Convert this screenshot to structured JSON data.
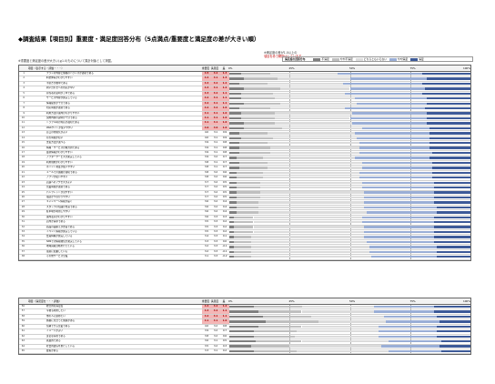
{
  "title": "◆調査結果【項目別】重要度・満足度回答分布（5点満点/重要度と満足度の差が大きい順）",
  "note_left": "※重要度と満足度の差が大きい(≧1.0)ものについて集計対象として掲載。",
  "note_right": [
    "※満足度の差が1.0以上の",
    "項目を赤で網掛けしています。"
  ],
  "legend": {
    "caption": "満足度の回答分布",
    "items": [
      {
        "label": "不満足",
        "color": "#7f7f7f"
      },
      {
        "label": "やや不満足",
        "color": "#bfbfbf"
      },
      {
        "label": "どちらともいえない",
        "color": "#dcdcdc"
      },
      {
        "label": "やや満足",
        "color": "#9aaed6"
      },
      {
        "label": "満足",
        "color": "#3d5a98"
      }
    ]
  },
  "section1": {
    "header": {
      "item": "項目（表示する・評価・・・）",
      "imp": "重要度",
      "sat": "満足度",
      "diff": "差",
      "ticks": [
        "0%",
        "25%",
        "50%",
        "75%",
        "100%"
      ]
    }
  },
  "section2": {
    "header": {
      "item": "項目（満足度を・・・評価）",
      "imp": "重要度",
      "sat": "満足度",
      "diff": "差",
      "ticks": [
        "0%",
        "25%",
        "50%",
        "75%",
        "100%"
      ]
    }
  },
  "rows1": [
    {
      "n": "1",
      "cat": "",
      "txt": "プランの内容と価格のバランスが適切である",
      "imp": "4.5",
      "sat": "3.2",
      "diff": "1.3",
      "red": true,
      "dist": [
        0.05,
        0.12,
        0.28,
        0.35,
        0.2
      ]
    },
    {
      "n": "2",
      "cat": "",
      "txt": "料金体系がわかりやすい",
      "imp": "4.4",
      "sat": "3.1",
      "diff": "1.3",
      "red": true,
      "dist": [
        0.06,
        0.14,
        0.3,
        0.32,
        0.18
      ]
    },
    {
      "n": "3",
      "cat": "",
      "txt": "手続きが簡単である",
      "imp": "4.4",
      "sat": "3.2",
      "diff": "1.2",
      "red": true,
      "dist": [
        0.04,
        0.12,
        0.31,
        0.33,
        0.2
      ]
    },
    {
      "n": "4",
      "cat": "",
      "txt": "問い合わせへの対応が早い",
      "imp": "4.3",
      "sat": "3.1",
      "diff": "1.2",
      "red": true,
      "dist": [
        0.06,
        0.15,
        0.29,
        0.31,
        0.19
      ]
    },
    {
      "n": "5",
      "cat": "",
      "txt": "担当者の説明が丁寧である",
      "imp": "4.3",
      "sat": "3.2",
      "diff": "1.1",
      "red": true,
      "dist": [
        0.05,
        0.13,
        0.3,
        0.32,
        0.2
      ]
    },
    {
      "n": "6",
      "cat": "",
      "txt": "サービス内容が充実している",
      "imp": "4.2",
      "sat": "3.1",
      "diff": "1.1",
      "red": true,
      "dist": [
        0.05,
        0.14,
        0.33,
        0.3,
        0.18
      ]
    },
    {
      "n": "7",
      "cat": "",
      "txt": "情報提供が十分である",
      "imp": "4.2",
      "sat": "3.1",
      "diff": "1.1",
      "red": true,
      "dist": [
        0.06,
        0.15,
        0.32,
        0.29,
        0.18
      ]
    },
    {
      "n": "8",
      "cat": "",
      "txt": "対応時間が適切である",
      "imp": "4.2",
      "sat": "3.2",
      "diff": "1.0",
      "red": true,
      "dist": [
        0.04,
        0.13,
        0.31,
        0.33,
        0.19
      ]
    },
    {
      "n": "9",
      "cat": "",
      "txt": "利用方法の案内がわかりやすい",
      "imp": "4.1",
      "sat": "3.1",
      "diff": "1.0",
      "red": true,
      "dist": [
        0.05,
        0.14,
        0.32,
        0.31,
        0.18
      ]
    },
    {
      "n": "10",
      "cat": "",
      "txt": "契約内容の説明が十分である",
      "imp": "4.1",
      "sat": "3.1",
      "diff": "1.0",
      "red": true,
      "dist": [
        0.05,
        0.14,
        0.31,
        0.32,
        0.18
      ]
    },
    {
      "n": "11",
      "cat": "",
      "txt": "トラブル時の対応が適切である",
      "imp": "4.1",
      "sat": "3.1",
      "diff": "1.0",
      "red": true,
      "dist": [
        0.06,
        0.13,
        0.32,
        0.31,
        0.18
      ]
    },
    {
      "n": "12",
      "cat": "",
      "txt": "Webサイトが使いやすい",
      "imp": "4.0",
      "sat": "3.0",
      "diff": "1.0",
      "red": true,
      "dist": [
        0.06,
        0.16,
        0.33,
        0.28,
        0.17
      ]
    },
    {
      "n": "13",
      "cat": "",
      "txt": "窓口の雰囲気がよい",
      "imp": "4.0",
      "sat": "3.1",
      "diff": "0.9",
      "red": false,
      "dist": [
        0.04,
        0.12,
        0.36,
        0.31,
        0.17
      ]
    },
    {
      "n": "14",
      "cat": "",
      "txt": "待ち時間が短い",
      "imp": "4.0",
      "sat": "3.1",
      "diff": "0.9",
      "red": false,
      "dist": [
        0.05,
        0.13,
        0.35,
        0.3,
        0.17
      ]
    },
    {
      "n": "15",
      "cat": "",
      "txt": "支払方法が選べる",
      "imp": "3.9",
      "sat": "3.1",
      "diff": "0.8",
      "red": false,
      "dist": [
        0.04,
        0.12,
        0.38,
        0.29,
        0.17
      ]
    },
    {
      "n": "16",
      "cat": "",
      "txt": "特典・サービスが魅力的である",
      "imp": "3.9",
      "sat": "3.1",
      "diff": "0.8",
      "red": false,
      "dist": [
        0.04,
        0.13,
        0.37,
        0.29,
        0.17
      ]
    },
    {
      "n": "17",
      "cat": "",
      "txt": "最新情報がわかりやすい",
      "imp": "3.9",
      "sat": "3.1",
      "diff": "0.8",
      "red": false,
      "dist": [
        0.04,
        0.13,
        0.37,
        0.3,
        0.16
      ]
    },
    {
      "n": "18",
      "cat": "",
      "txt": "アフターサービスが充実している",
      "imp": "3.9",
      "sat": "3.2",
      "diff": "0.7",
      "red": false,
      "dist": [
        0.03,
        0.11,
        0.38,
        0.31,
        0.17
      ]
    },
    {
      "n": "19",
      "cat": "",
      "txt": "利用規約がわかりやすい",
      "imp": "3.8",
      "sat": "3.1",
      "diff": "0.7",
      "red": false,
      "dist": [
        0.04,
        0.12,
        0.39,
        0.29,
        0.16
      ]
    },
    {
      "n": "20",
      "cat": "",
      "txt": "ポイント制度が使いやすい",
      "imp": "3.8",
      "sat": "3.1",
      "diff": "0.7",
      "red": false,
      "dist": [
        0.04,
        0.12,
        0.39,
        0.29,
        0.16
      ]
    },
    {
      "n": "21",
      "cat": "",
      "txt": "メールでの連絡が適切である",
      "imp": "3.8",
      "sat": "3.2",
      "diff": "0.6",
      "red": false,
      "dist": [
        0.03,
        0.11,
        0.4,
        0.3,
        0.16
      ]
    },
    {
      "n": "22",
      "cat": "",
      "txt": "アプリが使いやすい",
      "imp": "3.8",
      "sat": "3.2",
      "diff": "0.6",
      "red": false,
      "dist": [
        0.03,
        0.11,
        0.4,
        0.3,
        0.16
      ]
    },
    {
      "n": "23",
      "cat": "",
      "txt": "店舗へのアクセスがよい",
      "imp": "3.7",
      "sat": "3.2",
      "diff": "0.5",
      "red": false,
      "dist": [
        0.03,
        0.1,
        0.42,
        0.3,
        0.15
      ]
    },
    {
      "n": "24",
      "cat": "",
      "txt": "営業時間が適切である",
      "imp": "3.7",
      "sat": "3.2",
      "diff": "0.5",
      "red": false,
      "dist": [
        0.03,
        0.1,
        0.42,
        0.3,
        0.15
      ]
    },
    {
      "n": "25",
      "cat": "",
      "txt": "パンフレットが見やすい",
      "imp": "3.7",
      "sat": "3.2",
      "diff": "0.5",
      "red": false,
      "dist": [
        0.03,
        0.1,
        0.43,
        0.29,
        0.15
      ]
    },
    {
      "n": "26",
      "cat": "",
      "txt": "電話がつながりやすい",
      "imp": "3.7",
      "sat": "3.2",
      "diff": "0.5",
      "red": false,
      "dist": [
        0.03,
        0.1,
        0.43,
        0.29,
        0.15
      ]
    },
    {
      "n": "27",
      "cat": "",
      "txt": "キャンペーン情報が届く",
      "imp": "3.6",
      "sat": "3.2",
      "diff": "0.4",
      "red": false,
      "dist": [
        0.03,
        0.09,
        0.44,
        0.29,
        0.15
      ]
    },
    {
      "n": "28",
      "cat": "",
      "txt": "スタッフの知識が豊富である",
      "imp": "3.6",
      "sat": "3.2",
      "diff": "0.4",
      "red": false,
      "dist": [
        0.03,
        0.09,
        0.44,
        0.3,
        0.14
      ]
    },
    {
      "n": "29",
      "cat": "",
      "txt": "駐車場が利用しやすい",
      "imp": "3.6",
      "sat": "3.2",
      "diff": "0.4",
      "red": false,
      "dist": [
        0.03,
        0.09,
        0.45,
        0.29,
        0.14
      ]
    },
    {
      "n": "30",
      "cat": "",
      "txt": "案内表示がわかりやすい",
      "imp": "3.6",
      "sat": "3.3",
      "diff": "0.3",
      "red": false,
      "dist": [
        0.02,
        0.08,
        0.45,
        0.3,
        0.15
      ]
    },
    {
      "n": "31",
      "cat": "",
      "txt": "店内が清潔である",
      "imp": "3.5",
      "sat": "3.3",
      "diff": "0.2",
      "red": false,
      "dist": [
        0.02,
        0.08,
        0.45,
        0.3,
        0.15
      ]
    },
    {
      "n": "32",
      "cat": "",
      "txt": "商品の品揃えが豊富である",
      "imp": "3.5",
      "sat": "3.3",
      "diff": "0.2",
      "red": false,
      "dist": [
        0.02,
        0.08,
        0.46,
        0.29,
        0.15
      ]
    },
    {
      "n": "33",
      "cat": "",
      "txt": "イベント情報が充実している",
      "imp": "3.5",
      "sat": "3.3",
      "diff": "0.2",
      "red": false,
      "dist": [
        0.02,
        0.08,
        0.46,
        0.29,
        0.15
      ]
    },
    {
      "n": "34",
      "cat": "",
      "txt": "会員特典が充実している",
      "imp": "3.4",
      "sat": "3.3",
      "diff": "0.1",
      "red": false,
      "dist": [
        0.02,
        0.07,
        0.47,
        0.29,
        0.15
      ]
    },
    {
      "n": "35",
      "cat": "",
      "txt": "SNSでの情報発信が充実している",
      "imp": "3.3",
      "sat": "3.3",
      "diff": "0.0",
      "red": false,
      "dist": [
        0.02,
        0.07,
        0.48,
        0.28,
        0.15
      ]
    },
    {
      "n": "36",
      "cat": "",
      "txt": "地域貢献活動を行っている",
      "imp": "3.2",
      "sat": "3.3",
      "diff": "-0.1",
      "red": false,
      "dist": [
        0.02,
        0.07,
        0.49,
        0.28,
        0.14
      ]
    },
    {
      "n": "37",
      "cat": "",
      "txt": "環境に配慮している",
      "imp": "3.2",
      "sat": "3.3",
      "diff": "-0.1",
      "red": false,
      "dist": [
        0.02,
        0.07,
        0.49,
        0.28,
        0.14
      ]
    },
    {
      "n": "38",
      "cat": "",
      "txt": "その他サービス全般",
      "imp": "3.1",
      "sat": "3.3",
      "diff": "-0.2",
      "red": false,
      "dist": [
        0.02,
        0.07,
        0.5,
        0.27,
        0.14
      ]
    }
  ],
  "rows2": [
    {
      "n": "56",
      "cat": "",
      "txt": "総合的な満足度",
      "imp": "4.4",
      "sat": "3.2",
      "diff": "1.2",
      "red": true,
      "dist": [
        0.1,
        0.2,
        0.3,
        0.25,
        0.15
      ]
    },
    {
      "n": "57",
      "cat": "",
      "txt": "今後も利用したい",
      "imp": "4.3",
      "sat": "3.2",
      "diff": "1.1",
      "red": true,
      "dist": [
        0.12,
        0.18,
        0.3,
        0.25,
        0.15
      ]
    },
    {
      "n": "58",
      "cat": "",
      "txt": "他の人に勧めたい",
      "imp": "4.2",
      "sat": "3.1",
      "diff": "1.1",
      "red": true,
      "dist": [
        0.14,
        0.2,
        0.3,
        0.22,
        0.14
      ]
    },
    {
      "n": "59",
      "cat": "",
      "txt": "価格に見合った価値がある",
      "imp": "4.1",
      "sat": "3.1",
      "diff": "1.0",
      "red": true,
      "dist": [
        0.15,
        0.22,
        0.28,
        0.22,
        0.13
      ]
    },
    {
      "n": "60",
      "cat": "",
      "txt": "信頼できる企業である",
      "imp": "4.0",
      "sat": "3.2",
      "diff": "0.8",
      "red": false,
      "dist": [
        0.12,
        0.18,
        0.32,
        0.24,
        0.14
      ]
    },
    {
      "n": "61",
      "cat": "",
      "txt": "イメージがよい",
      "imp": "3.9",
      "sat": "3.2",
      "diff": "0.7",
      "red": false,
      "dist": [
        0.1,
        0.18,
        0.34,
        0.24,
        0.14
      ]
    },
    {
      "n": "62",
      "cat": "",
      "txt": "身近な存在である",
      "imp": "3.8",
      "sat": "3.2",
      "diff": "0.6",
      "red": false,
      "dist": [
        0.1,
        0.17,
        0.35,
        0.24,
        0.14
      ]
    },
    {
      "n": "63",
      "cat": "",
      "txt": "先進的である",
      "imp": "3.6",
      "sat": "3.1",
      "diff": "0.5",
      "red": false,
      "dist": [
        0.11,
        0.19,
        0.36,
        0.22,
        0.12
      ]
    },
    {
      "n": "64",
      "cat": "",
      "txt": "社会的責任を果たしている",
      "imp": "3.5",
      "sat": "3.2",
      "diff": "0.3",
      "red": false,
      "dist": [
        0.09,
        0.16,
        0.38,
        0.24,
        0.13
      ]
    },
    {
      "n": "65",
      "cat": "",
      "txt": "愛着がある",
      "imp": "3.3",
      "sat": "3.1",
      "diff": "0.2",
      "red": false,
      "dist": [
        0.1,
        0.18,
        0.38,
        0.22,
        0.12
      ]
    }
  ]
}
